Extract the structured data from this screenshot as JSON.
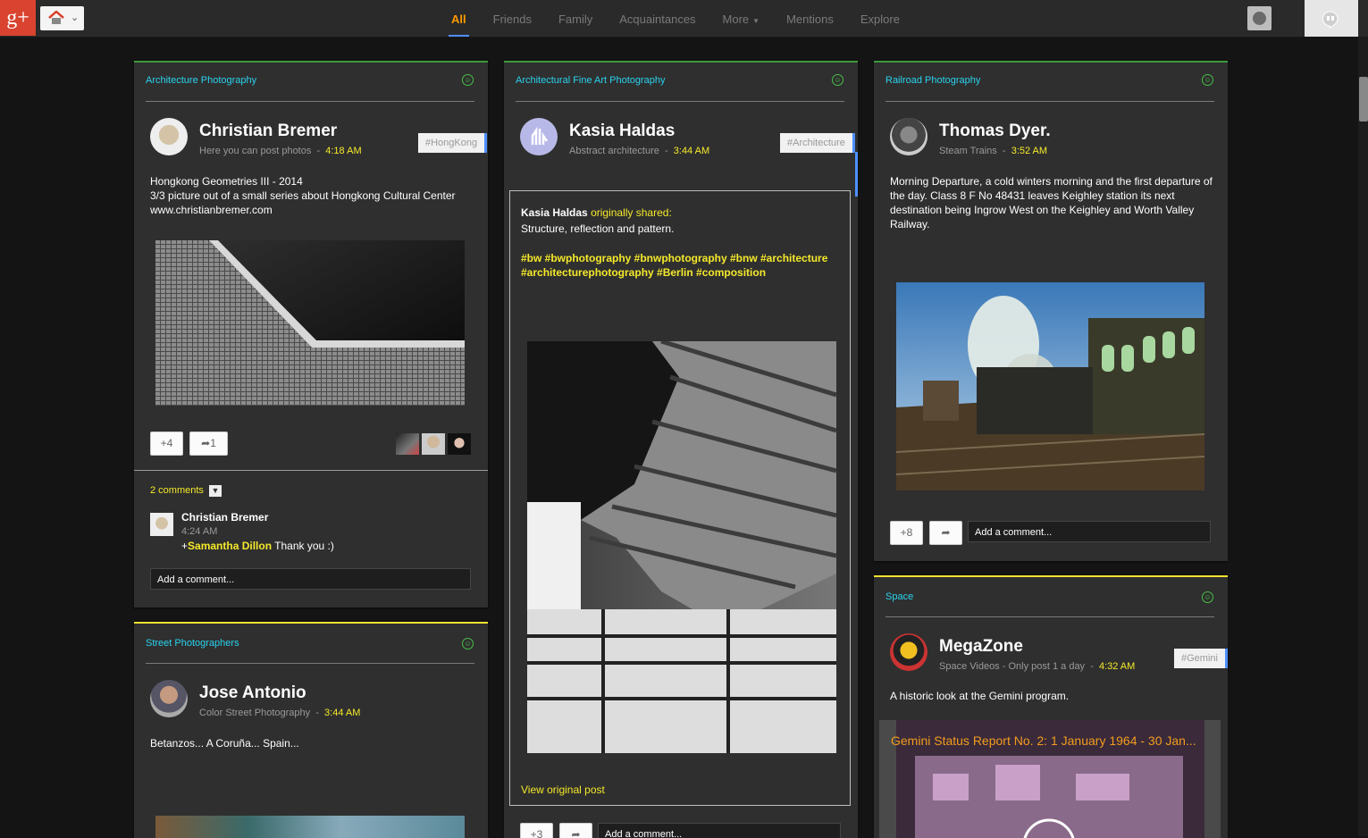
{
  "topbar": {
    "logo": "g+",
    "tabs": [
      {
        "label": "All"
      },
      {
        "label": "Friends"
      },
      {
        "label": "Family"
      },
      {
        "label": "Acquaintances"
      },
      {
        "label": "More"
      },
      {
        "label": "Mentions"
      },
      {
        "label": "Explore"
      }
    ]
  },
  "posts": [
    {
      "community": "Architecture Photography",
      "author": "Christian Bremer",
      "category": "Here you can post photos",
      "time": "4:18 AM",
      "hashtag": "#HongKong",
      "text": [
        "Hongkong Geometries III - 2014",
        "3/3 picture out of a small series about Hongkong Cultural Center",
        "www.christianbremer.com"
      ],
      "plus": "+4",
      "shares": "1",
      "comments_label": "2 comments",
      "comment": {
        "author": "Christian Bremer",
        "time": "4:24 AM",
        "mention": "Samantha Dillon",
        "text": " Thank you :)"
      },
      "add_comment": "Add a comment..."
    },
    {
      "community": "Street Photographers",
      "author": "Jose Antonio",
      "category": "Color Street Photography",
      "time": "3:44 AM",
      "text": "Betanzos... A Coruña... Spain..."
    },
    {
      "community": "Architectural Fine Art Photography",
      "author": "Kasia Haldas",
      "category": "Abstract architecture",
      "time": "3:44 AM",
      "hashtag": "#Architecture",
      "shared_author": "Kasia Haldas",
      "shared_label": "originally shared:",
      "shared_text": "Structure, reflection and pattern.",
      "shared_tags": [
        "#bw #bwphotography #bnwphotography #bnw #architecture",
        "#architecturephotography #Berlin #composition"
      ],
      "view_original": "View original post",
      "plus": "+3",
      "add_comment": "Add a comment..."
    },
    {
      "community": "Railroad Photography",
      "author": "Thomas Dyer.",
      "category": "Steam Trains",
      "time": "3:52 AM",
      "text": [
        "Morning Departure, a cold winters morning and the first departure of",
        "the day. Class 8 F No 48431 leaves Keighley station its next",
        "destination being Ingrow West on the Keighley and Worth Valley",
        "Railway."
      ],
      "plus": "+8",
      "add_comment": "Add a comment..."
    },
    {
      "community": "Space",
      "author": "MegaZone",
      "category": "Space Videos - Only post 1 a day",
      "time": "4:32 AM",
      "hashtag": "#Gemini",
      "text": "A historic look at the Gemini program.",
      "video_title": "Gemini Status Report No. 2: 1 January 1964 - 30 Jan..."
    }
  ],
  "colors": {
    "accent": "#ff9900",
    "community": "#29d3ef",
    "time": "#f5e92b",
    "green_border": "#3c9a3c",
    "yellow_border": "#f2e230"
  }
}
